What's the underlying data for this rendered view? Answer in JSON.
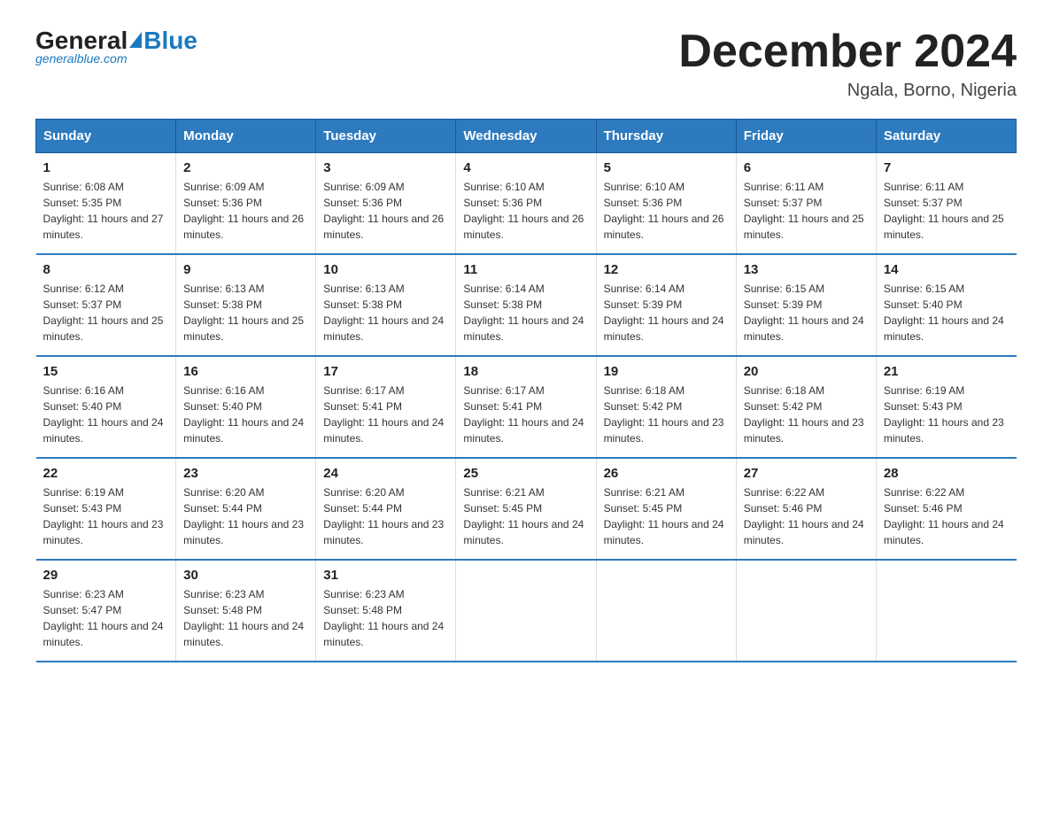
{
  "logo": {
    "general": "General",
    "blue": "Blue",
    "tagline": "generalblue.com"
  },
  "title": "December 2024",
  "subtitle": "Ngala, Borno, Nigeria",
  "days_of_week": [
    "Sunday",
    "Monday",
    "Tuesday",
    "Wednesday",
    "Thursday",
    "Friday",
    "Saturday"
  ],
  "weeks": [
    [
      {
        "num": "1",
        "sunrise": "6:08 AM",
        "sunset": "5:35 PM",
        "daylight": "11 hours and 27 minutes."
      },
      {
        "num": "2",
        "sunrise": "6:09 AM",
        "sunset": "5:36 PM",
        "daylight": "11 hours and 26 minutes."
      },
      {
        "num": "3",
        "sunrise": "6:09 AM",
        "sunset": "5:36 PM",
        "daylight": "11 hours and 26 minutes."
      },
      {
        "num": "4",
        "sunrise": "6:10 AM",
        "sunset": "5:36 PM",
        "daylight": "11 hours and 26 minutes."
      },
      {
        "num": "5",
        "sunrise": "6:10 AM",
        "sunset": "5:36 PM",
        "daylight": "11 hours and 26 minutes."
      },
      {
        "num": "6",
        "sunrise": "6:11 AM",
        "sunset": "5:37 PM",
        "daylight": "11 hours and 25 minutes."
      },
      {
        "num": "7",
        "sunrise": "6:11 AM",
        "sunset": "5:37 PM",
        "daylight": "11 hours and 25 minutes."
      }
    ],
    [
      {
        "num": "8",
        "sunrise": "6:12 AM",
        "sunset": "5:37 PM",
        "daylight": "11 hours and 25 minutes."
      },
      {
        "num": "9",
        "sunrise": "6:13 AM",
        "sunset": "5:38 PM",
        "daylight": "11 hours and 25 minutes."
      },
      {
        "num": "10",
        "sunrise": "6:13 AM",
        "sunset": "5:38 PM",
        "daylight": "11 hours and 24 minutes."
      },
      {
        "num": "11",
        "sunrise": "6:14 AM",
        "sunset": "5:38 PM",
        "daylight": "11 hours and 24 minutes."
      },
      {
        "num": "12",
        "sunrise": "6:14 AM",
        "sunset": "5:39 PM",
        "daylight": "11 hours and 24 minutes."
      },
      {
        "num": "13",
        "sunrise": "6:15 AM",
        "sunset": "5:39 PM",
        "daylight": "11 hours and 24 minutes."
      },
      {
        "num": "14",
        "sunrise": "6:15 AM",
        "sunset": "5:40 PM",
        "daylight": "11 hours and 24 minutes."
      }
    ],
    [
      {
        "num": "15",
        "sunrise": "6:16 AM",
        "sunset": "5:40 PM",
        "daylight": "11 hours and 24 minutes."
      },
      {
        "num": "16",
        "sunrise": "6:16 AM",
        "sunset": "5:40 PM",
        "daylight": "11 hours and 24 minutes."
      },
      {
        "num": "17",
        "sunrise": "6:17 AM",
        "sunset": "5:41 PM",
        "daylight": "11 hours and 24 minutes."
      },
      {
        "num": "18",
        "sunrise": "6:17 AM",
        "sunset": "5:41 PM",
        "daylight": "11 hours and 24 minutes."
      },
      {
        "num": "19",
        "sunrise": "6:18 AM",
        "sunset": "5:42 PM",
        "daylight": "11 hours and 23 minutes."
      },
      {
        "num": "20",
        "sunrise": "6:18 AM",
        "sunset": "5:42 PM",
        "daylight": "11 hours and 23 minutes."
      },
      {
        "num": "21",
        "sunrise": "6:19 AM",
        "sunset": "5:43 PM",
        "daylight": "11 hours and 23 minutes."
      }
    ],
    [
      {
        "num": "22",
        "sunrise": "6:19 AM",
        "sunset": "5:43 PM",
        "daylight": "11 hours and 23 minutes."
      },
      {
        "num": "23",
        "sunrise": "6:20 AM",
        "sunset": "5:44 PM",
        "daylight": "11 hours and 23 minutes."
      },
      {
        "num": "24",
        "sunrise": "6:20 AM",
        "sunset": "5:44 PM",
        "daylight": "11 hours and 23 minutes."
      },
      {
        "num": "25",
        "sunrise": "6:21 AM",
        "sunset": "5:45 PM",
        "daylight": "11 hours and 24 minutes."
      },
      {
        "num": "26",
        "sunrise": "6:21 AM",
        "sunset": "5:45 PM",
        "daylight": "11 hours and 24 minutes."
      },
      {
        "num": "27",
        "sunrise": "6:22 AM",
        "sunset": "5:46 PM",
        "daylight": "11 hours and 24 minutes."
      },
      {
        "num": "28",
        "sunrise": "6:22 AM",
        "sunset": "5:46 PM",
        "daylight": "11 hours and 24 minutes."
      }
    ],
    [
      {
        "num": "29",
        "sunrise": "6:23 AM",
        "sunset": "5:47 PM",
        "daylight": "11 hours and 24 minutes."
      },
      {
        "num": "30",
        "sunrise": "6:23 AM",
        "sunset": "5:48 PM",
        "daylight": "11 hours and 24 minutes."
      },
      {
        "num": "31",
        "sunrise": "6:23 AM",
        "sunset": "5:48 PM",
        "daylight": "11 hours and 24 minutes."
      },
      null,
      null,
      null,
      null
    ]
  ],
  "sunrise_label": "Sunrise:",
  "sunset_label": "Sunset:",
  "daylight_label": "Daylight:"
}
